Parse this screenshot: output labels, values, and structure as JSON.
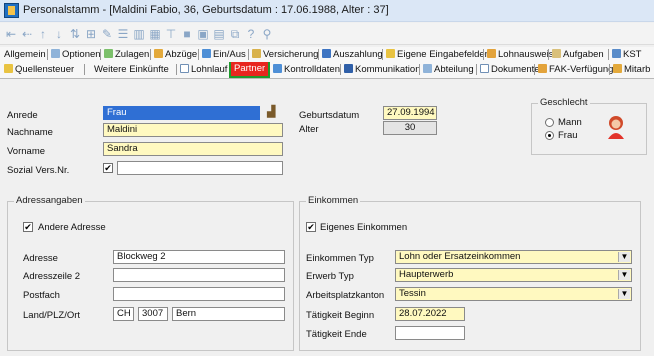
{
  "window": {
    "title": "Personalstamm - [Maldini Fabio, 36, Geburtsdatum : 17.06.1988, Alter : 37]"
  },
  "tabs_row1": [
    "Allgemein",
    "Optionen",
    "Zulagen",
    "Abzüge",
    "Ein/Aus",
    "Versicherung",
    "Auszahlung",
    "Eigene Eingabefelder",
    "Lohnausweis",
    "Aufgaben",
    "KST"
  ],
  "tabs_row2": [
    "Quellensteuer",
    "Weitere Einkünfte",
    "Lohnlauf",
    "Partner",
    "Kontrolldaten",
    "Kommunikation",
    "Abteilung",
    "Dokumente",
    "FAK-Verfügung",
    "Mitarb"
  ],
  "person": {
    "anrede_label": "Anrede",
    "anrede_value": "Frau",
    "nachname_label": "Nachname",
    "nachname_value": "Maldini",
    "vorname_label": "Vorname",
    "vorname_value": "Sandra",
    "sozial_label": "Sozial Vers.Nr.",
    "sozial_check": "✔",
    "geburtsdatum_label": "Geburtsdatum",
    "geburtsdatum_value": "27.09.1994",
    "alter_label": "Alter",
    "alter_value": "30"
  },
  "geschlecht": {
    "title": "Geschlecht",
    "mann": "Mann",
    "frau": "Frau",
    "selected": "Frau"
  },
  "adresse": {
    "title": "Adressangaben",
    "andere_label": "Andere Adresse",
    "andere_check": "✔",
    "adresse_label": "Adresse",
    "adresse_value": "Blockweg 2",
    "zeile2_label": "Adresszeile 2",
    "zeile2_value": "",
    "postfach_label": "Postfach",
    "postfach_value": "",
    "land_label": "Land/PLZ/Ort",
    "land_value": "CH",
    "plz_value": "3007",
    "ort_value": "Bern"
  },
  "einkommen": {
    "title": "Einkommen",
    "eigenes_label": "Eigenes Einkommen",
    "eigenes_check": "✔",
    "typ_label": "Einkommen Typ",
    "typ_value": "Lohn oder Ersatzeinkommen",
    "erwerb_label": "Erwerb Typ",
    "erwerb_value": "Haupterwerb",
    "kanton_label": "Arbeitsplatzkanton",
    "kanton_value": "Tessin",
    "beginn_label": "Tätigkeit Beginn",
    "beginn_value": "28.07.2022",
    "ende_label": "Tätigkeit Ende",
    "ende_value": ""
  },
  "colors": {
    "active_tab": "#e8261f",
    "active_tab_outline": "#1e9b2d",
    "mandatory_field": "#fff9c0",
    "selected_field": "#2f6fd4"
  }
}
